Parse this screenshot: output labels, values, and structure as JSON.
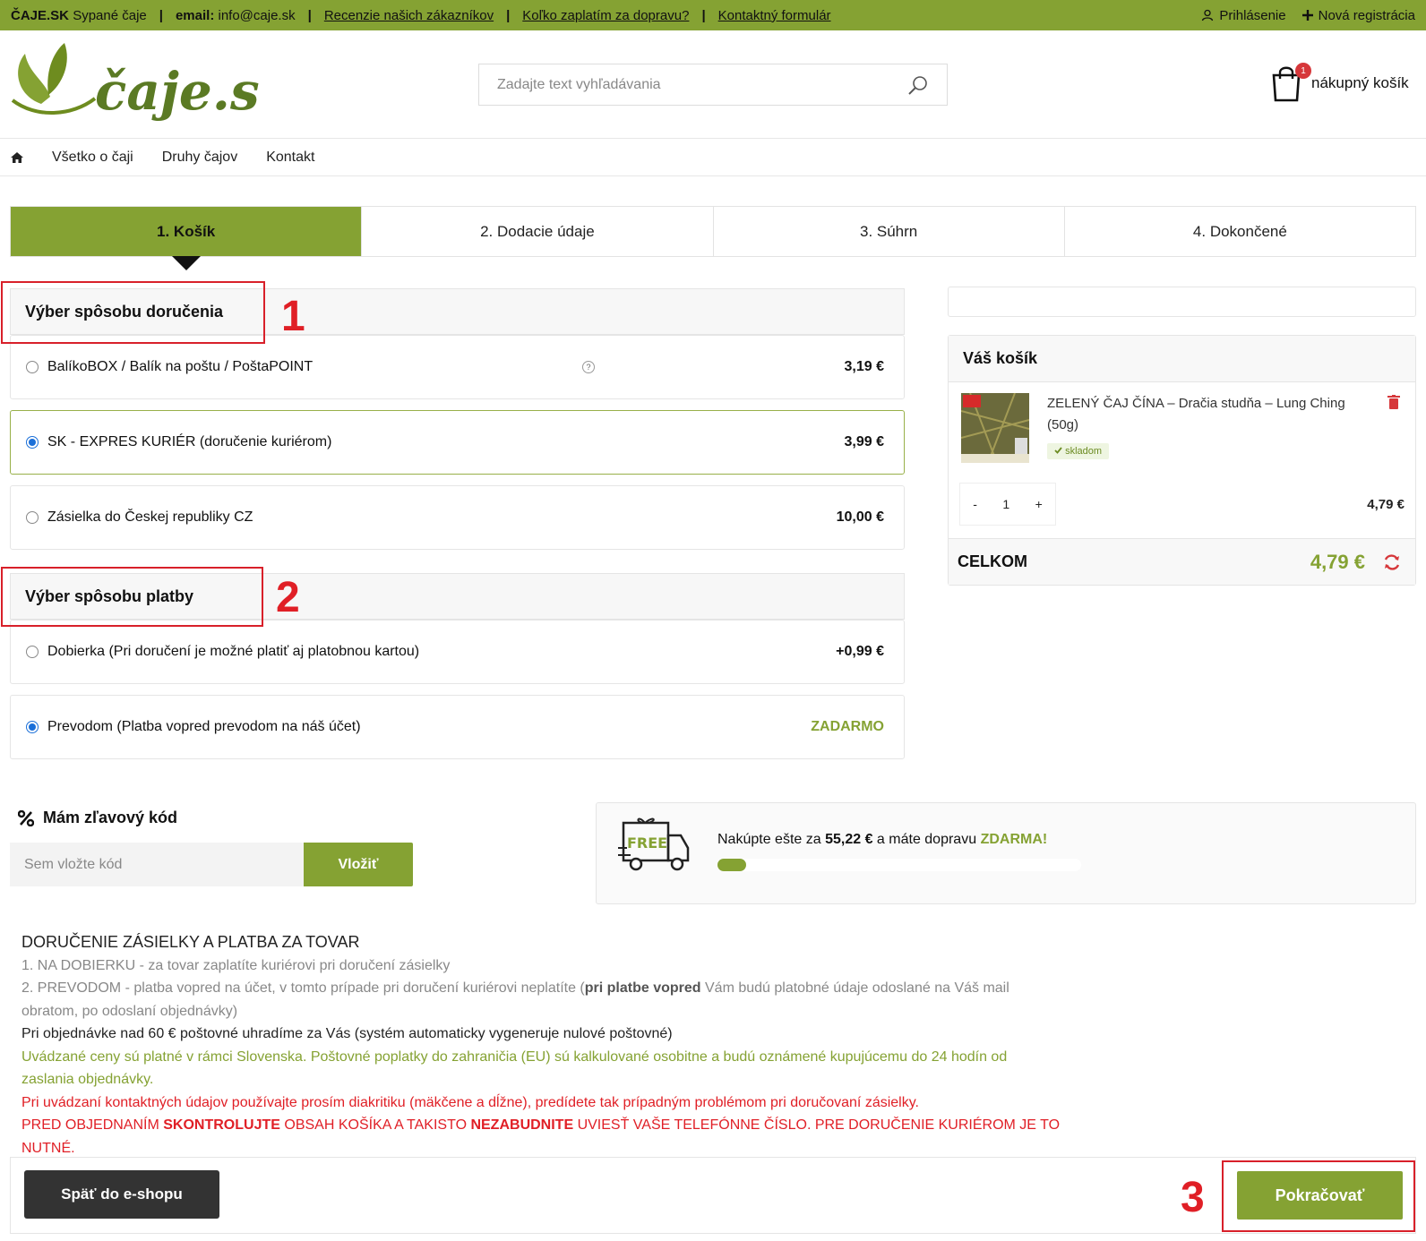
{
  "topbar": {
    "brand": "ČAJE.SK",
    "brand_sub": "Sypané čaje",
    "email_label": "email:",
    "email": "info@caje.sk",
    "links": [
      "Recenzie našich zákazníkov",
      "Koľko zaplatím za dopravu?",
      "Kontaktný formulár"
    ],
    "login": "Prihlásenie",
    "register": "Nová registrácia"
  },
  "header": {
    "logo_text": "čaje.sk",
    "search_placeholder": "Zadajte text vyhľadávania",
    "cart_label": "nákupný košík",
    "cart_count": "1"
  },
  "nav": {
    "items": [
      "Všetko o čaji",
      "Druhy čajov",
      "Kontakt"
    ]
  },
  "steps": [
    "1. Košík",
    "2. Dodacie údaje",
    "3. Súhrn",
    "4. Dokončené"
  ],
  "delivery": {
    "title": "Výber spôsobu doručenia",
    "options": [
      {
        "label": "BalíkoBOX / Balík na poštu / PoštaPOINT",
        "price": "3,19 €",
        "selected": false
      },
      {
        "label": "SK - EXPRES KURIÉR (doručenie kuriérom)",
        "price": "3,99 €",
        "selected": true
      },
      {
        "label": "Zásielka do Českej republiky CZ",
        "price": "10,00 €",
        "selected": false
      }
    ]
  },
  "payment": {
    "title": "Výber spôsobu platby",
    "options": [
      {
        "label": "Dobierka (Pri doručení je možné platiť aj platobnou kartou)",
        "price": "+0,99 €",
        "selected": false
      },
      {
        "label": "Prevodom (Platba vopred prevodom na náš účet)",
        "price": "ZADARMO",
        "selected": true
      }
    ]
  },
  "annotations": {
    "one": "1",
    "two": "2",
    "three": "3"
  },
  "cart": {
    "title": "Váš košík",
    "product_name": "ZELENÝ ČAJ ČÍNA – Dračia studňa – Lung Ching (50g)",
    "stock": "skladom",
    "qty_minus": "-",
    "qty": "1",
    "qty_plus": "+",
    "line_price": "4,79 €",
    "total_label": "CELKOM",
    "total_value": "4,79 €"
  },
  "coupon": {
    "title": "Mám zľavový kód",
    "placeholder": "Sem vložte kód",
    "button": "Vložiť"
  },
  "free_shipping": {
    "truck_label": "FREE",
    "text_before": "Nakúpte ešte za",
    "amount": "55,22 €",
    "text_middle": "a máte dopravu",
    "text_end": "ZDARMA!",
    "progress": 0.08
  },
  "info": {
    "heading": "DORUČENIE ZÁSIELKY A PLATBA ZA TOVAR",
    "line1": "1. NA DOBIERKU - za tovar zaplatíte kuriérovi pri doručení zásielky",
    "line2a": "2. PREVODOM - platba vopred na účet, v tomto prípade pri doručení kuriérovi neplatíte (",
    "line2b": "pri platbe vopred",
    "line2c": " Vám budú platobné údaje odoslané na Váš mail obratom, po odoslaní objednávky)",
    "line3": "Pri objednávke nad 60 € poštovné uhradíme za Vás (systém automaticky vygeneruje nulové poštovné)",
    "line4": "Uvádzané ceny sú platné v rámci Slovenska. Poštovné poplatky do zahraničia (EU) sú kalkulované osobitne a budú oznámené kupujúcemu do 24 hodín od zaslania objednávky.",
    "line5": "Pri uvádzaní kontaktných údajov používajte prosím diakritiku (mäkčene a dĺžne), predídete tak prípadným problémom pri doručovaní zásielky.",
    "line6a": "PRED OBJEDNANÍM ",
    "line6b": "SKONTROLUJTE",
    "line6c": " OBSAH KOŠÍKA A TAKISTO ",
    "line6d": "NEZABUDNITE",
    "line6e": " UVIESŤ VAŠE TELEFÓNNE ČÍSLO. PRE DORUČENIE KURIÉROM JE TO NUTNÉ."
  },
  "footer": {
    "back": "Späť do e-shopu",
    "continue": "Pokračovať"
  },
  "colors": {
    "accent": "#85a233",
    "annotation": "#e01f26",
    "dark_button": "#333333"
  }
}
